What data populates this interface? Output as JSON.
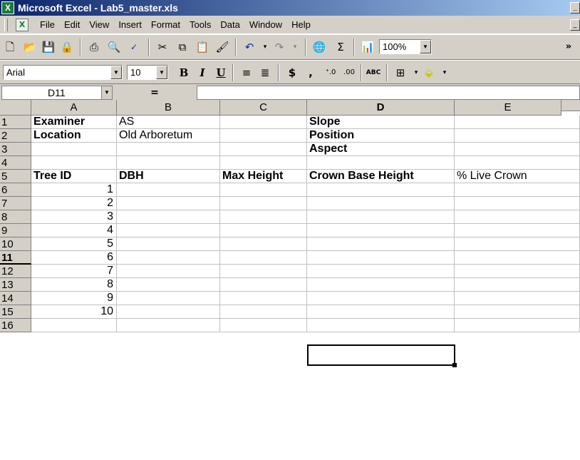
{
  "window": {
    "title": "Microsoft Excel - Lab5_master.xls",
    "app_icon": "excel-icon"
  },
  "menu": {
    "items": [
      {
        "label": "File",
        "u": "F"
      },
      {
        "label": "Edit",
        "u": "E"
      },
      {
        "label": "View",
        "u": "V"
      },
      {
        "label": "Insert",
        "u": "I"
      },
      {
        "label": "Format",
        "u": "o"
      },
      {
        "label": "Tools",
        "u": "T"
      },
      {
        "label": "Data",
        "u": "D"
      },
      {
        "label": "Window",
        "u": "W"
      },
      {
        "label": "Help",
        "u": "H"
      }
    ]
  },
  "toolbar": {
    "zoom": "100%",
    "overflow": "»"
  },
  "format_toolbar": {
    "font": "Arial",
    "size": "10",
    "bold": "B",
    "italic": "I",
    "underline": "U",
    "currency": "$",
    "comma": ","
  },
  "formula_bar": {
    "name_box": "D11",
    "equals": "="
  },
  "sheet": {
    "columns": [
      "A",
      "B",
      "C",
      "D",
      "E"
    ],
    "active_column": "D",
    "active_row": 11,
    "rows": [
      {
        "n": 1,
        "A": "Examiner",
        "B": "AS",
        "C": "",
        "D": "Slope",
        "E": ""
      },
      {
        "n": 2,
        "A": "Location",
        "B": "Old Arboretum",
        "C": "",
        "D": "Position",
        "E": ""
      },
      {
        "n": 3,
        "A": "",
        "B": "",
        "C": "",
        "D": "Aspect",
        "E": ""
      },
      {
        "n": 4,
        "A": "",
        "B": "",
        "C": "",
        "D": "",
        "E": ""
      },
      {
        "n": 5,
        "A": "Tree ID",
        "B": "DBH",
        "C": "Max Height",
        "D": "Crown Base Height",
        "E": "% Live Crown"
      },
      {
        "n": 6,
        "A": "1",
        "B": "",
        "C": "",
        "D": "",
        "E": ""
      },
      {
        "n": 7,
        "A": "2",
        "B": "",
        "C": "",
        "D": "",
        "E": ""
      },
      {
        "n": 8,
        "A": "3",
        "B": "",
        "C": "",
        "D": "",
        "E": ""
      },
      {
        "n": 9,
        "A": "4",
        "B": "",
        "C": "",
        "D": "",
        "E": ""
      },
      {
        "n": 10,
        "A": "5",
        "B": "",
        "C": "",
        "D": "",
        "E": ""
      },
      {
        "n": 11,
        "A": "6",
        "B": "",
        "C": "",
        "D": "",
        "E": ""
      },
      {
        "n": 12,
        "A": "7",
        "B": "",
        "C": "",
        "D": "",
        "E": ""
      },
      {
        "n": 13,
        "A": "8",
        "B": "",
        "C": "",
        "D": "",
        "E": ""
      },
      {
        "n": 14,
        "A": "9",
        "B": "",
        "C": "",
        "D": "",
        "E": ""
      },
      {
        "n": 15,
        "A": "10",
        "B": "",
        "C": "",
        "D": "",
        "E": ""
      },
      {
        "n": 16,
        "A": "",
        "B": "",
        "C": "",
        "D": "",
        "E": ""
      }
    ]
  }
}
